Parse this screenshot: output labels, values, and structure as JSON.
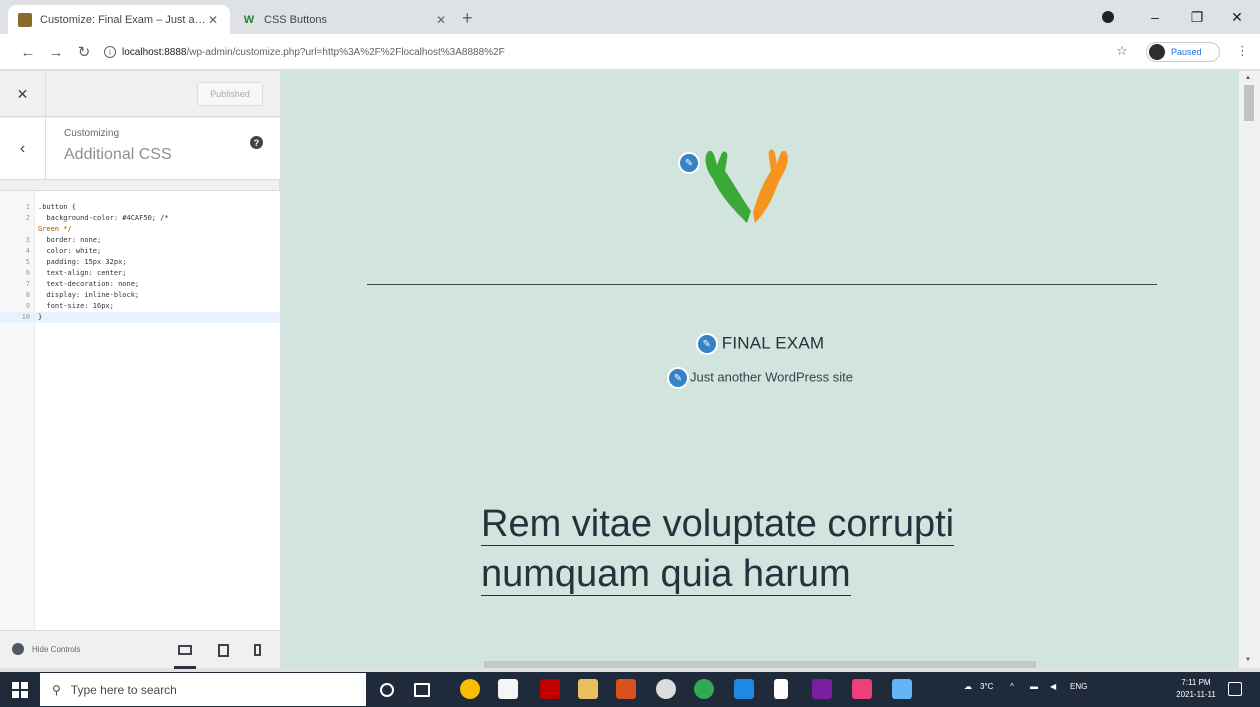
{
  "browser": {
    "tabs": [
      {
        "title": "Customize: Final Exam – Just an…",
        "favicon": "wordpress-favicon",
        "close": "✕"
      },
      {
        "title": "CSS Buttons",
        "favicon": "w3schools-favicon",
        "favicon_text": "W",
        "close": "✕"
      }
    ],
    "new_tab": "+",
    "url_host": "localhost:8888",
    "url_path": "/wp-admin/customize.php?url=http%3A%2F%2Flocalhost%3A8888%2F",
    "profile_label": "Paused",
    "window_controls": {
      "minimize": "–",
      "maximize": "❐",
      "close": "✕"
    }
  },
  "customizer": {
    "publish_label": "Published",
    "breadcrumb": "Customizing",
    "section_title": "Additional CSS",
    "css_lines": [
      {
        "n": "1",
        "text": ".button {"
      },
      {
        "n": "2",
        "text": "  background-color: #4CAF50; /*"
      },
      {
        "n": "",
        "text": "Green */"
      },
      {
        "n": "3",
        "text": "  border: none;"
      },
      {
        "n": "4",
        "text": "  color: white;"
      },
      {
        "n": "5",
        "text": "  padding: 15px 32px;"
      },
      {
        "n": "6",
        "text": "  text-align: center;"
      },
      {
        "n": "7",
        "text": "  text-decoration: none;"
      },
      {
        "n": "8",
        "text": "  display: inline-block;"
      },
      {
        "n": "9",
        "text": "  font-size: 16px;"
      },
      {
        "n": "10",
        "text": "}"
      }
    ],
    "hide_controls_label": "Hide Controls"
  },
  "preview": {
    "site_title": "FINAL EXAM",
    "site_description": "Just another WordPress site",
    "post_title_line1": "Rem vitae voluptate corrupti",
    "post_title_line2": "numquam quia harum"
  },
  "taskbar": {
    "search_placeholder": "Type here to search",
    "weather": "3°C",
    "language": "ENG",
    "time": "7:11 PM",
    "date": "2021-11-11"
  },
  "colors": {
    "preview_bg": "#d1e4dd",
    "sidebar_bg": "#f0f0f1",
    "taskbar_bg": "#1f2a3a",
    "accent_blue": "#3582c4",
    "logo_green": "#3aa935",
    "logo_orange": "#f7941d"
  }
}
